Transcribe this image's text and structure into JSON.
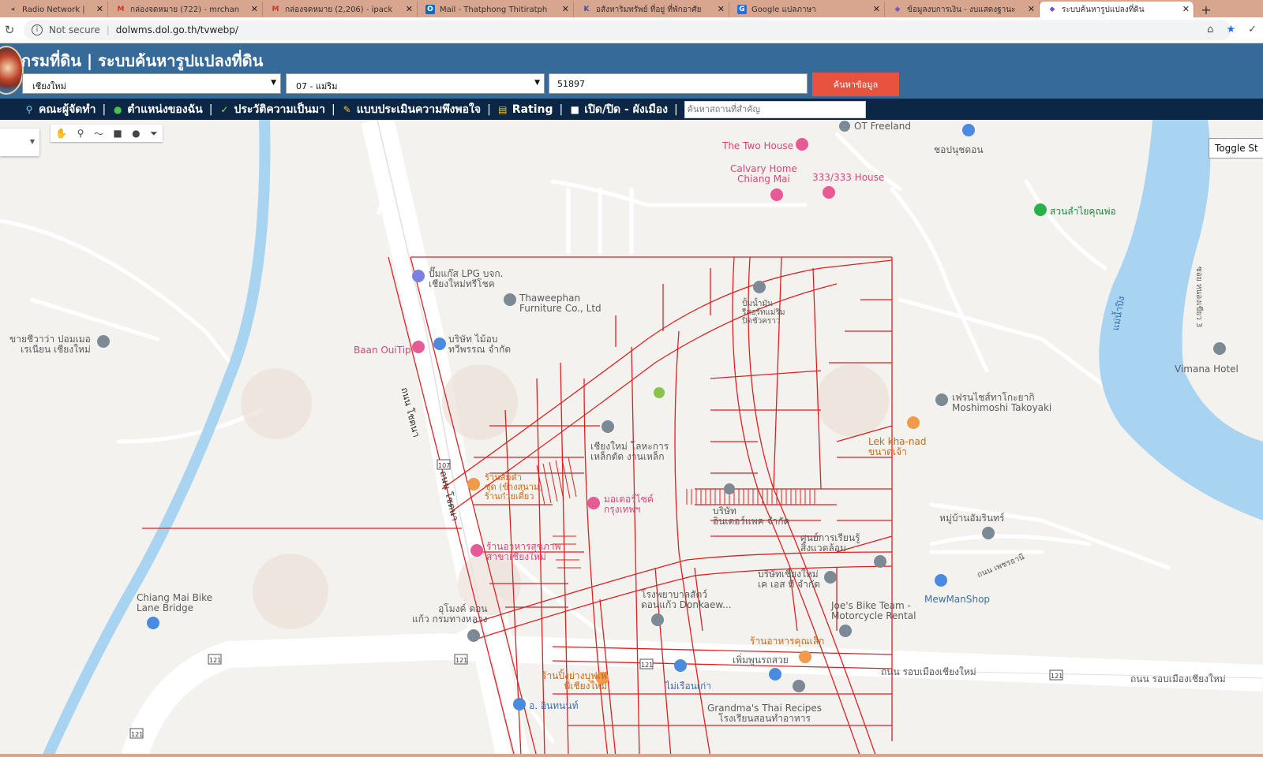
{
  "browser": {
    "tabs": [
      {
        "label": "Radio Network |",
        "icon": "radio-icon",
        "icon_color": "#888888"
      },
      {
        "label": "กล่องจดหมาย (722) - mrchan",
        "icon": "gmail-icon",
        "icon_color": "#d93025"
      },
      {
        "label": "กล่องจดหมาย (2,206) - ipack",
        "icon": "gmail-icon",
        "icon_color": "#d93025"
      },
      {
        "label": "Mail - Thatphong Thitiratph",
        "icon": "outlook-icon",
        "icon_color": "#0f6cbd"
      },
      {
        "label": "อสังหาริมทรัพย์ ที่อยู่ ที่พักอาศัย",
        "icon": "k-icon",
        "icon_color": "#3c4fa8"
      },
      {
        "label": "Google แปลภาษา",
        "icon": "translate-icon",
        "icon_color": "#1a73e8"
      },
      {
        "label": "ข้อมูลงบการเงิน - งบแสดงฐานะ",
        "icon": "cube-icon",
        "icon_color": "#6a5acd"
      },
      {
        "label": "ระบบค้นหารูปแปลงที่ดิน",
        "icon": "cube-icon",
        "icon_color": "#6a5acd",
        "active": true
      }
    ],
    "security_label": "Not secure",
    "url": "dolwms.dol.go.th/tvwebp/"
  },
  "header": {
    "title": "กรมที่ดิน | ระบบค้นหารูปแปลงที่ดิน",
    "province": "เชียงใหม่",
    "district": "07 - แม่ริม",
    "parcel_number": "51897",
    "search_button": "ค้นหาข้อมูล"
  },
  "menu": {
    "items": [
      {
        "label": "คณะผู้จัดทำ",
        "icon": "people-icon"
      },
      {
        "label": "ตำแหน่งของฉัน",
        "icon": "globe-icon"
      },
      {
        "label": "ประวัติความเป็นมา",
        "icon": "sprout-icon"
      },
      {
        "label": "แบบประเมินความพึงพอใจ",
        "icon": "form-icon"
      },
      {
        "label": "Rating",
        "icon": "chart-icon"
      },
      {
        "label": "เปิด/ปิด - ผังเมือง",
        "icon": "checkbox-icon"
      }
    ],
    "place_search_placeholder": "ค้นหาสถานที่สำคัญ"
  },
  "map": {
    "toggle_button": "Toggle St",
    "labels": [
      {
        "text": "OT Freeland",
        "style": "gray"
      },
      {
        "text": "The Two House",
        "style": "pink"
      },
      {
        "text": "ชอปนุชดอน",
        "style": "gray"
      },
      {
        "text": "Calvary Home\nChiang Mai",
        "style": "pink"
      },
      {
        "text": "333/333 House",
        "style": "pink"
      },
      {
        "text": "สวนลำไยคุณพ่อ",
        "style": "green"
      },
      {
        "text": "ปั๊มแก๊ส LPG บจก.\nเชียงใหม่ทรีโชค",
        "style": "gray"
      },
      {
        "text": "Thaweephan\nFurniture Co., Ltd",
        "style": "gray"
      },
      {
        "text": "ปั้มน้ำมัน\nรีสอร์ทแม่ริม\nปิดชั่วคราว",
        "style": "gray"
      },
      {
        "text": "ขายชีวาว่า ปอมเมอ\nเรเนียน เชียงใหม่",
        "style": "gray"
      },
      {
        "text": "Baan OuiTip",
        "style": "pink"
      },
      {
        "text": "บริษัท ไม้อบ\nทวีพรรณ จำกัด",
        "style": "gray"
      },
      {
        "text": "ถนน โชตนา",
        "style": "dark"
      },
      {
        "text": "เฟรนไชส์ทาโกะยากิ\nMoshimoshi Takoyaki",
        "style": "gray"
      },
      {
        "text": "Vimana Hotel",
        "style": "gray"
      },
      {
        "text": "แม่น้ำปิง",
        "style": "blue"
      },
      {
        "text": "ซอย หนองเขียว 3",
        "style": "gray"
      },
      {
        "text": "Lek kha-nad\nขนาดเจ้า",
        "style": "orange"
      },
      {
        "text": "เชียงใหม่ โลหะการ\nเหล็กตัด งานเหล็ก",
        "style": "gray"
      },
      {
        "text": "ร้านส้มตำ\nชุด (ข้างสนาม)\nร้านก๋วยเตี๋ยว",
        "style": "orange"
      },
      {
        "text": "ถนน โชตนา",
        "style": "dark"
      },
      {
        "text": "มอเตอร์ไซค์\nกรุงเทพฯ",
        "style": "pink"
      },
      {
        "text": "บริษัท\nอินเตอร์แพค จำกัด",
        "style": "gray"
      },
      {
        "text": "หมู่บ้านอัมรินทร์",
        "style": "gray"
      },
      {
        "text": "ศูนย์การเรียนรู้\nสิ่งแวดล้อม",
        "style": "gray"
      },
      {
        "text": "ร้านอาหารสุขภาพ\nสาขาเชียงใหม่",
        "style": "pink"
      },
      {
        "text": "ถนน เพชรธานี",
        "style": "gray"
      },
      {
        "text": "MewManShop",
        "style": "blue"
      },
      {
        "text": "บริษัทเชียงใหม่\nเค เอส ที จำกัด",
        "style": "gray"
      },
      {
        "text": "โรงพยาบาลสัตว์\nดอนแก้ว Donkaew...",
        "style": "gray"
      },
      {
        "text": "Joe's Bike Team -\nMotorcycle Rental",
        "style": "gray"
      },
      {
        "text": "Chiang Mai Bike\nLane Bridge",
        "style": "gray"
      },
      {
        "text": "อุโมงค์ ดอน\nแก้ว กรมทางหลวง",
        "style": "gray"
      },
      {
        "text": "ร้านอาหารคุณเล็ก",
        "style": "orange"
      },
      {
        "text": "เพิ่มพูนรถสวย",
        "style": "gray"
      },
      {
        "text": "ถนน รอบเมืองเชียงใหม่",
        "style": "gray"
      },
      {
        "text": "ถนน รอบเมืองเชียงใหม่",
        "style": "gray"
      },
      {
        "text": "ร้านปิ้งย่างบุฟเฟ่\nพี่เชียงใหม่",
        "style": "orange"
      },
      {
        "text": "ไม่เรือนเก่า",
        "style": "blue"
      },
      {
        "text": "อ. อินทนนท์",
        "style": "blue"
      },
      {
        "text": "Grandma's Thai Recipes\nโรงเรียนสอนทำอาหาร",
        "style": "gray"
      }
    ],
    "route_shields": [
      "107",
      "121",
      "121",
      "121",
      "121",
      "121"
    ]
  }
}
